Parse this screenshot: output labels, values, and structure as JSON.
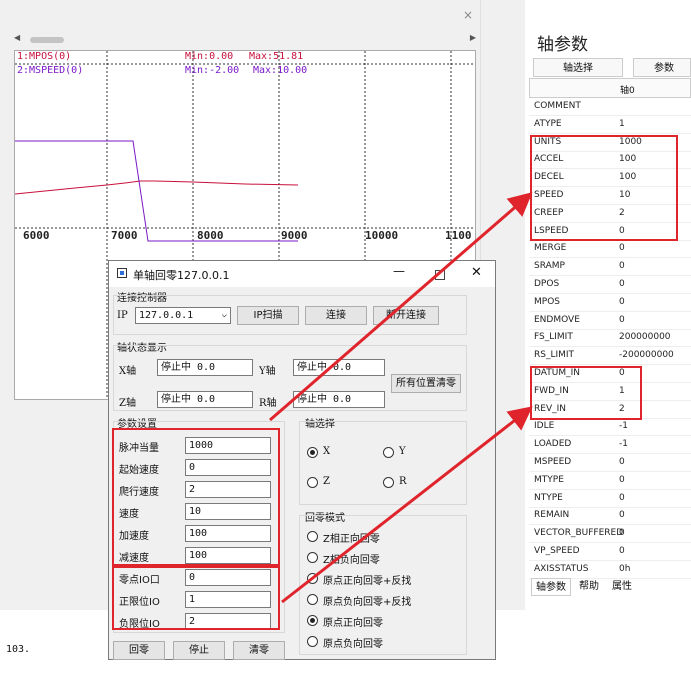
{
  "chart_window": {
    "legend": [
      {
        "name": "1:MPOS(0)",
        "min": "Min:0.00",
        "max": "Max:51.81",
        "color": "#c8103c"
      },
      {
        "name": "2:MSPEED(0)",
        "min": "Min:-2.00",
        "max": "Max:10.00",
        "color": "#7a18c8"
      }
    ],
    "x_ticks": [
      "6000",
      "7000",
      "8000",
      "9000",
      "10000",
      "1100"
    ],
    "status_text": "103."
  },
  "axis_params": {
    "title": "轴参数",
    "select_button": "轴选择",
    "params_button": "参数",
    "column_header": "轴0",
    "rows": [
      {
        "name": "COMMENT",
        "value": ""
      },
      {
        "name": "ATYPE",
        "value": "1"
      },
      {
        "name": "UNITS",
        "value": "1000"
      },
      {
        "name": "ACCEL",
        "value": "100"
      },
      {
        "name": "DECEL",
        "value": "100"
      },
      {
        "name": "SPEED",
        "value": "10"
      },
      {
        "name": "CREEP",
        "value": "2"
      },
      {
        "name": "LSPEED",
        "value": "0"
      },
      {
        "name": "MERGE",
        "value": "0"
      },
      {
        "name": "SRAMP",
        "value": "0"
      },
      {
        "name": "DPOS",
        "value": "0"
      },
      {
        "name": "MPOS",
        "value": "0"
      },
      {
        "name": "ENDMOVE",
        "value": "0"
      },
      {
        "name": "FS_LIMIT",
        "value": "200000000"
      },
      {
        "name": "RS_LIMIT",
        "value": "-200000000"
      },
      {
        "name": "DATUM_IN",
        "value": "0"
      },
      {
        "name": "FWD_IN",
        "value": "1"
      },
      {
        "name": "REV_IN",
        "value": "2"
      },
      {
        "name": "IDLE",
        "value": "-1"
      },
      {
        "name": "LOADED",
        "value": "-1"
      },
      {
        "name": "MSPEED",
        "value": "0"
      },
      {
        "name": "MTYPE",
        "value": "0"
      },
      {
        "name": "NTYPE",
        "value": "0"
      },
      {
        "name": "REMAIN",
        "value": "0"
      },
      {
        "name": "VECTOR_BUFFERED",
        "value": "0"
      },
      {
        "name": "VP_SPEED",
        "value": "0"
      },
      {
        "name": "AXISSTATUS",
        "value": "0h"
      }
    ],
    "tabs": [
      "轴参数",
      "帮助",
      "属性"
    ]
  },
  "dialog": {
    "title": "单轴回零127.0.0.1",
    "connect_group": "连接控制器",
    "ip_label": "IP",
    "ip_value": "127.0.0.1",
    "ip_scan": "IP扫描",
    "connect": "连接",
    "disconnect": "断开连接",
    "status_group": "轴状态显示",
    "axes_status": [
      {
        "label": "X轴",
        "value": "停止中  0.0"
      },
      {
        "label": "Y轴",
        "value": "停止中  0.0"
      },
      {
        "label": "Z轴",
        "value": "停止中  0.0"
      },
      {
        "label": "R轴",
        "value": "停止中  0.0"
      }
    ],
    "clear_all": "所有位置清零",
    "param_group": "参数设置",
    "params": [
      {
        "label": "脉冲当量",
        "value": "1000"
      },
      {
        "label": "起始速度",
        "value": "0"
      },
      {
        "label": "爬行速度",
        "value": "2"
      },
      {
        "label": "速度",
        "value": "10"
      },
      {
        "label": "加速度",
        "value": "100"
      },
      {
        "label": "减速度",
        "value": "100"
      },
      {
        "label": "零点IO口",
        "value": "0"
      },
      {
        "label": "正限位IO",
        "value": "1"
      },
      {
        "label": "负限位IO",
        "value": "2"
      }
    ],
    "axis_group": "轴选择",
    "axis_options": [
      {
        "label": "X",
        "checked": true
      },
      {
        "label": "Y",
        "checked": false
      },
      {
        "label": "Z",
        "checked": false
      },
      {
        "label": "R",
        "checked": false
      }
    ],
    "mode_group": "回零模式",
    "modes": [
      {
        "label": "Z相正向回零",
        "checked": false
      },
      {
        "label": "Z相负向回零",
        "checked": false
      },
      {
        "label": "原点正向回零+反找",
        "checked": false
      },
      {
        "label": "原点负向回零+反找",
        "checked": false
      },
      {
        "label": "原点正向回零",
        "checked": true
      },
      {
        "label": "原点负向回零",
        "checked": false
      }
    ],
    "home_button": "回零",
    "stop_button": "停止",
    "clear_button": "清零"
  },
  "colors": {
    "highlight": "#e0242c",
    "mpos": "#c8103c",
    "mspeed": "#7a18c8"
  }
}
